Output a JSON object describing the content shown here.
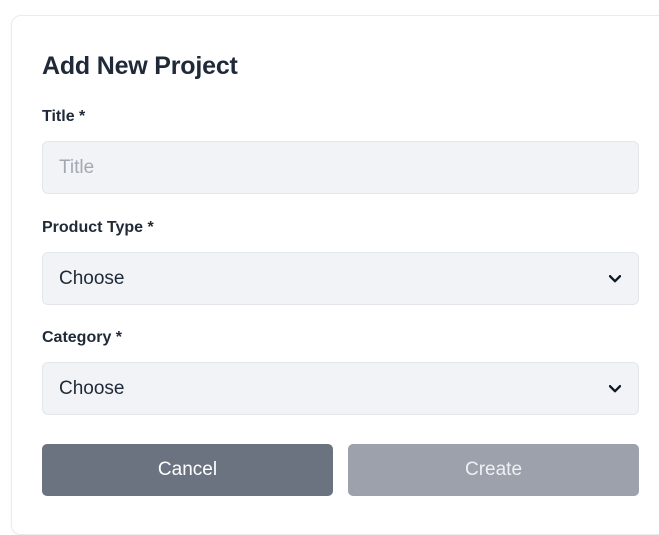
{
  "form": {
    "heading": "Add New Project",
    "title_field": {
      "label": "Title *",
      "placeholder": "Title",
      "value": ""
    },
    "product_type_field": {
      "label": "Product Type *",
      "selected": "Choose"
    },
    "category_field": {
      "label": "Category *",
      "selected": "Choose"
    },
    "buttons": {
      "cancel_label": "Cancel",
      "create_label": "Create"
    }
  },
  "colors": {
    "cancel_button": "#6b7280",
    "create_button": "#9ca1ab",
    "field_background": "#f1f3f6"
  },
  "icons": {
    "select_arrow": "chevron-down-icon"
  }
}
